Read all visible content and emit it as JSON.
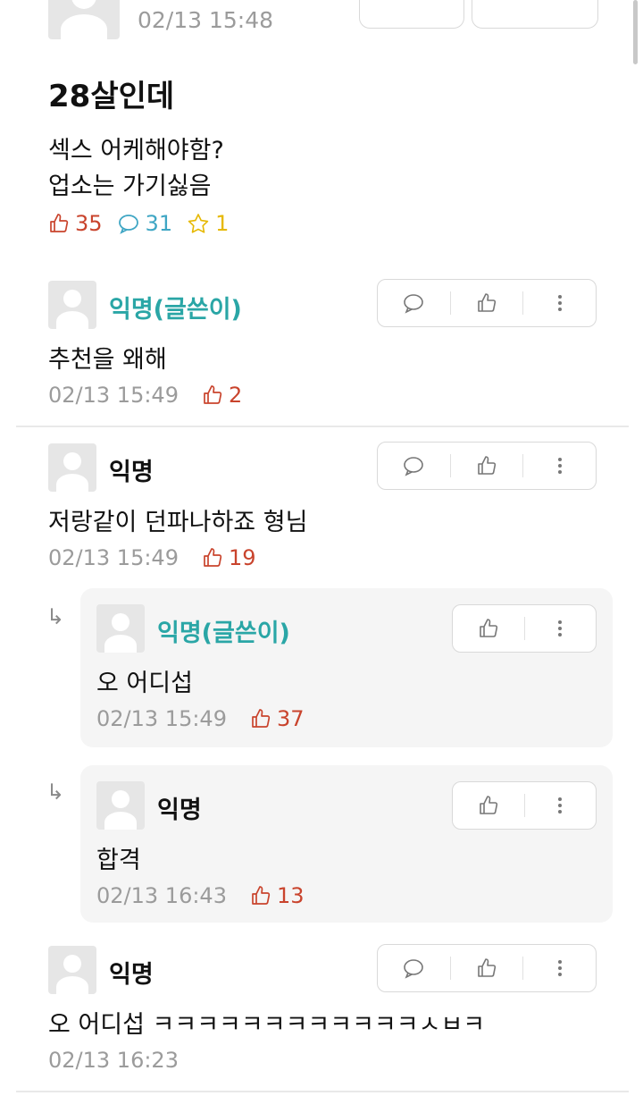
{
  "post": {
    "time": "02/13 15:48",
    "title": "28살인데",
    "body_line1": "섹스 어케해야함?",
    "body_line2": "업소는 가기싫음",
    "likes": "35",
    "comments": "31",
    "scraps": "1"
  },
  "comments": [
    {
      "author": "익명(글쓴이)",
      "text": "추천을 왜해",
      "time": "02/13 15:49",
      "likes": "2"
    },
    {
      "author": "익명",
      "text": "저랑같이 던파나하죠 형님",
      "time": "02/13 15:49",
      "likes": "19"
    },
    {
      "author": "익명(글쓴이)",
      "text": "오 어디섭",
      "time": "02/13 15:49",
      "likes": "37"
    },
    {
      "author": "익명",
      "text": "합격",
      "time": "02/13 16:43",
      "likes": "13"
    },
    {
      "author": "익명",
      "text": "오 어디섭 ㅋㅋㅋㅋㅋㅋㅋㅋㅋㅋㅋㅋㅅㅂㅋ",
      "time": "02/13 16:23"
    }
  ],
  "colors": {
    "author_highlight": "#2aa6a6",
    "like": "#c9442d",
    "comment": "#3fa6c4",
    "scrap": "#e6b800"
  }
}
